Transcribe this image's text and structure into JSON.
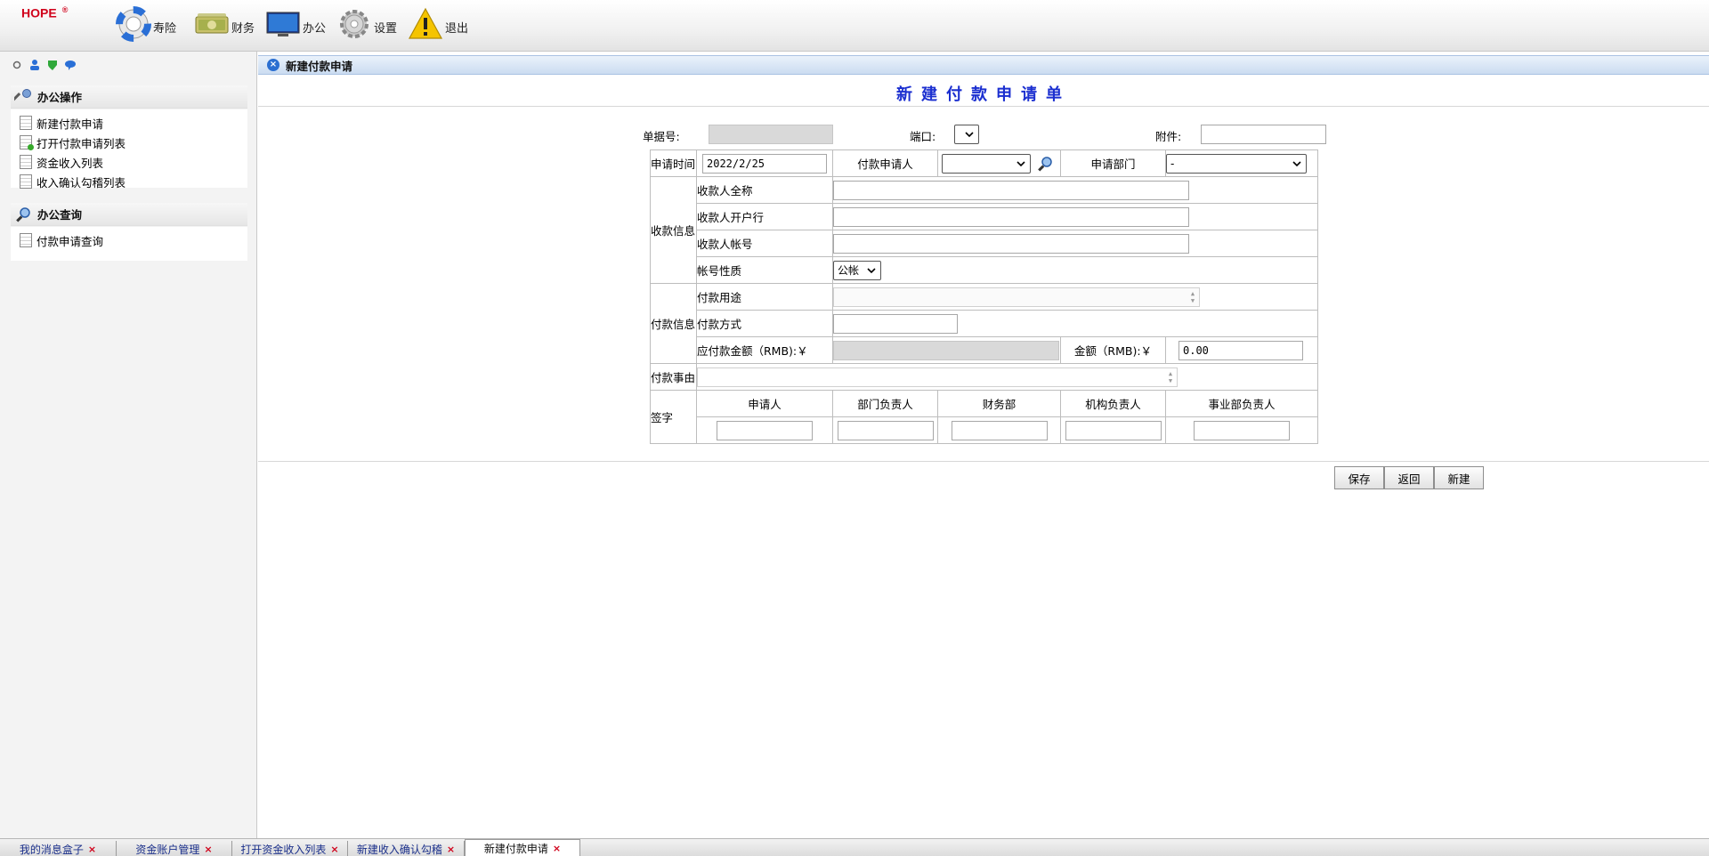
{
  "app": {
    "logo": "HOPE",
    "logo_mark": "®"
  },
  "nav": [
    {
      "label": "寿险",
      "icon": "lifebuoy-icon"
    },
    {
      "label": "财务",
      "icon": "money-icon"
    },
    {
      "label": "办公",
      "icon": "monitor-icon"
    },
    {
      "label": "设置",
      "icon": "gear-icon"
    },
    {
      "label": "退出",
      "icon": "warning-icon"
    }
  ],
  "sidebar": {
    "sections": [
      {
        "title": "办公操作",
        "icon": "wrench-icon",
        "items": [
          "新建付款申请",
          "打开付款申请列表",
          "资金收入列表",
          "收入确认勾稽列表"
        ]
      },
      {
        "title": "办公查询",
        "icon": "magnifier-icon",
        "items": [
          "付款申请查询"
        ]
      }
    ]
  },
  "panel": {
    "title": "新建付款申请"
  },
  "form": {
    "title": "新建付款申请单",
    "doc_no_label": "单据号:",
    "doc_no_value": "",
    "port_label": "端口:",
    "port_value": "",
    "attachment_label": "附件:",
    "attachment_value": "",
    "apply_time_label": "申请时间",
    "apply_time_value": "2022/2/25",
    "applicant_label": "付款申请人",
    "applicant_value": "",
    "dept_label": "申请部门",
    "dept_value": "-",
    "payee_group": "收款信息",
    "payee_name_label": "收款人全称",
    "payee_bank_label": "收款人开户行",
    "payee_account_label": "收款人帐号",
    "account_type_label": "帐号性质",
    "account_type_value": "公帐",
    "payment_group": "付款信息",
    "purpose_label": "付款用途",
    "method_label": "付款方式",
    "payable_label": "应付款金额（RMB):￥",
    "amount_label": "金额（RMB):￥",
    "amount_value": "0.00",
    "reason_label": "付款事由",
    "sign_label": "签字",
    "signers": [
      "申请人",
      "部门负责人",
      "财务部",
      "机构负责人",
      "事业部负责人"
    ]
  },
  "buttons": {
    "save": "保存",
    "back": "返回",
    "new": "新建"
  },
  "tabs": [
    {
      "label": "我的消息盒子",
      "active": false
    },
    {
      "label": "资金账户管理",
      "active": false
    },
    {
      "label": "打开资金收入列表",
      "active": false
    },
    {
      "label": "新建收入确认勾稽",
      "active": false
    },
    {
      "label": "新建付款申请",
      "active": true
    }
  ],
  "colors": {
    "title_blue": "#1b2fd0",
    "logo_red": "#d0021b",
    "tab_close": "#d0021b"
  }
}
